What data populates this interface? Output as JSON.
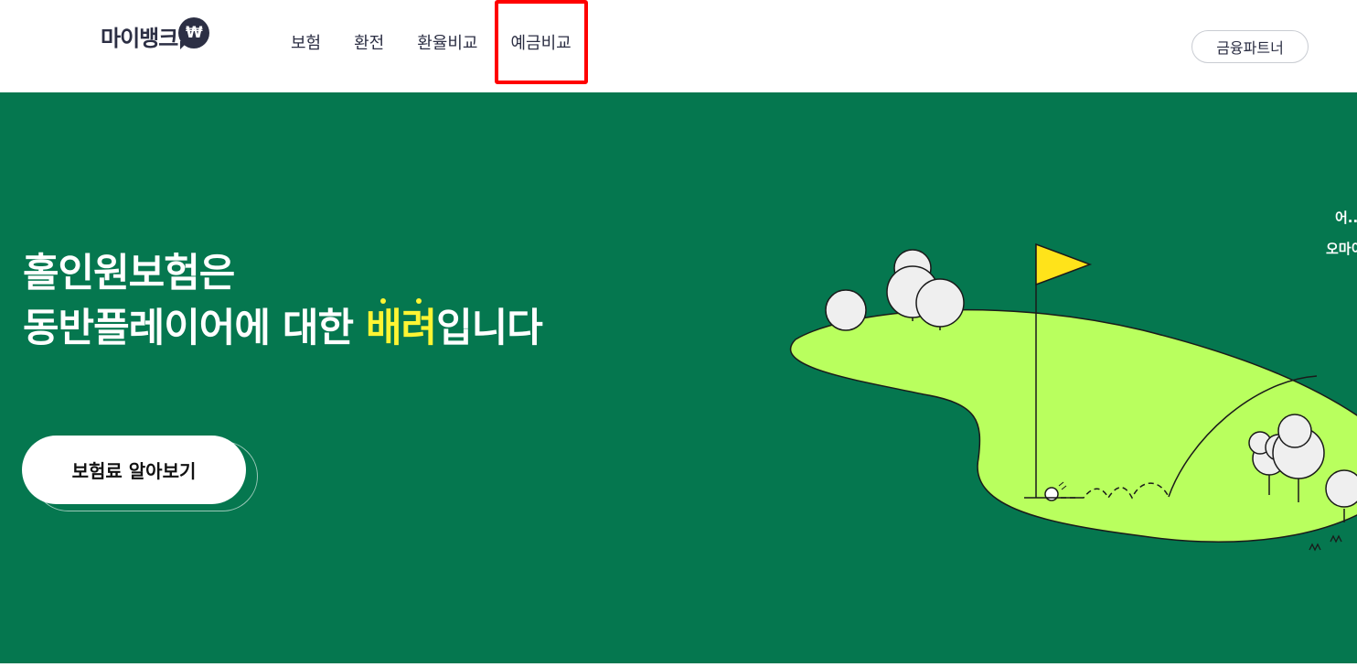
{
  "header": {
    "logo_text": "마이뱅크",
    "logo_badge": "₩",
    "nav": [
      {
        "label": "보험"
      },
      {
        "label": "환전"
      },
      {
        "label": "환율비교"
      },
      {
        "label": "예금비교"
      }
    ],
    "partner_button": "금융파트너"
  },
  "hero": {
    "title_line1": "홀인원보험은",
    "title_line2_prefix": "동반플레이어에 대한 ",
    "title_line2_accent": "배려",
    "title_line2_suffix": "입니다",
    "cta_label": "보험료 알아보기",
    "speech_line1": "어...",
    "speech_line2": "오마이"
  },
  "colors": {
    "brand_dark": "#2c2f44",
    "hero_bg": "#05774f",
    "accent_yellow": "#fff533",
    "green_fairway": "#b9ff5e",
    "highlight_box": "#ff0000"
  },
  "icons": {
    "logo_badge": "won-icon",
    "flag": "golf-flag-icon",
    "ball": "golf-ball-icon"
  }
}
